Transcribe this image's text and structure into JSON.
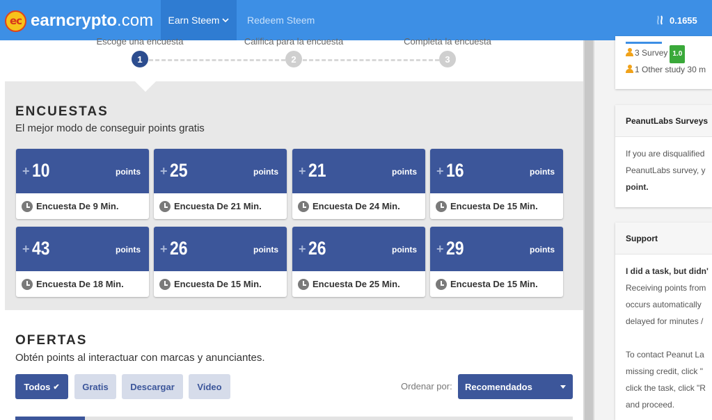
{
  "header": {
    "logo_mark": "ec",
    "logo_bold": "earncrypto",
    "logo_tld": ".com",
    "nav": [
      {
        "label": "Earn Steem",
        "active": true
      },
      {
        "label": "Redeem Steem",
        "active": false
      }
    ],
    "balance": "0.1655"
  },
  "steps": [
    {
      "label": "Escoge una encuesta",
      "number": "1",
      "active": true
    },
    {
      "label": "Califica para la encuesta",
      "number": "2",
      "active": false
    },
    {
      "label": "Completa la encuesta",
      "number": "3",
      "active": false
    }
  ],
  "surveys": {
    "title": "ENCUESTAS",
    "subtitle": "El mejor modo de conseguir points gratis",
    "unit": "points",
    "cards": [
      {
        "plus": "+",
        "value": "10",
        "duration": "Encuesta De 9 Min."
      },
      {
        "plus": "+",
        "value": "25",
        "duration": "Encuesta De 21 Min."
      },
      {
        "plus": "+",
        "value": "21",
        "duration": "Encuesta De 24 Min."
      },
      {
        "plus": "+",
        "value": "16",
        "duration": "Encuesta De 15 Min."
      },
      {
        "plus": "+",
        "value": "43",
        "duration": "Encuesta De 18 Min."
      },
      {
        "plus": "+",
        "value": "26",
        "duration": "Encuesta De 15 Min."
      },
      {
        "plus": "+",
        "value": "26",
        "duration": "Encuesta De 25 Min."
      },
      {
        "plus": "+",
        "value": "29",
        "duration": "Encuesta De 15 Min."
      }
    ]
  },
  "offers": {
    "title": "OFERTAS",
    "subtitle": "Obtén points al interactuar con marcas y anunciantes.",
    "filters": [
      {
        "label": "Todos",
        "active": true
      },
      {
        "label": "Gratis",
        "active": false
      },
      {
        "label": "Descargar",
        "active": false
      },
      {
        "label": "Video",
        "active": false
      }
    ],
    "check": "✔",
    "sort_label": "Ordenar por:",
    "sort_value": "Recomendados"
  },
  "sidebar": {
    "activity": [
      {
        "count": "3",
        "text": "Survey",
        "badge": "1.0"
      },
      {
        "count": "1",
        "text": "Other study 30 m",
        "badge": ""
      }
    ],
    "peanut": {
      "title": "PeanutLabs Surveys",
      "lines": [
        "If you are disqualified",
        "PeanutLabs survey, y",
        "point."
      ]
    },
    "support": {
      "title": "Support",
      "lines": [
        "I did a task, but didn'",
        "Receiving points from",
        "occurs automatically",
        "delayed for minutes /",
        "",
        "To contact Peanut La",
        "missing credit, click \"",
        "click the task, click \"R",
        "and proceed."
      ]
    }
  },
  "colors": {
    "topbar": "#3d8fe5",
    "topbar_active": "#2f7cd2",
    "card_blue": "#3c569a",
    "badge_green": "#3aa93a",
    "logo_yellow": "#f7c21a"
  }
}
